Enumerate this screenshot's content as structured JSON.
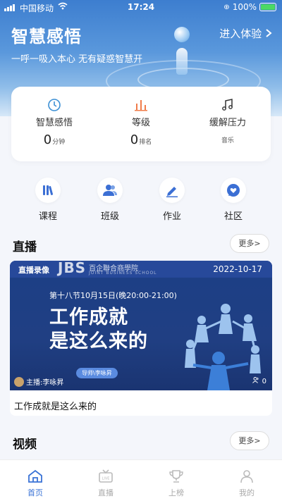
{
  "status_bar": {
    "carrier": "中国移动",
    "time": "17:24",
    "battery": "100%"
  },
  "header": {
    "title": "智慧感悟",
    "enter_label": "进入体验",
    "slogan": "一呼一吸入本心 无有疑惑智慧开"
  },
  "stats": [
    {
      "icon": "clock-icon",
      "label": "智慧感悟",
      "value": "0",
      "unit": "分钟"
    },
    {
      "icon": "bar-level-icon",
      "label": "等级",
      "value": "0",
      "unit": "排名"
    },
    {
      "icon": "music-note-icon",
      "label": "缓解压力",
      "sub": "音乐"
    }
  ],
  "entries": [
    {
      "icon": "books-icon",
      "label": "课程"
    },
    {
      "icon": "group-icon",
      "label": "班级"
    },
    {
      "icon": "pencil-icon",
      "label": "作业"
    },
    {
      "icon": "heart-chat-icon",
      "label": "社区"
    }
  ],
  "live": {
    "title": "直播",
    "more": "更多>",
    "card": {
      "tag": "直播录像",
      "logo": "JBS",
      "logo_cn": "百企聯合商學院",
      "logo_en": "JOINT BUSINESS SCHOOL",
      "date": "2022-10-17",
      "session": "第十八节10月15日(晚20:00-21:00)",
      "headline_line1": "工作成就",
      "headline_line2": "是这么来的",
      "teacher_pill": "导师\\李咏昇",
      "host": "主播:李咏昇",
      "viewers": "0",
      "title": "工作成就是这么来的"
    }
  },
  "video": {
    "title": "视频",
    "more": "更多>"
  },
  "tabbar": [
    {
      "icon": "home-icon",
      "label": "首页",
      "active": true
    },
    {
      "icon": "live-tv-icon",
      "label": "直播"
    },
    {
      "icon": "trophy-icon",
      "label": "上榜"
    },
    {
      "icon": "person-icon",
      "label": "我的"
    }
  ],
  "colors": {
    "accent": "#3a73d6",
    "icon_blue": "#3b6fd4",
    "level_orange": "#f07c4a"
  }
}
